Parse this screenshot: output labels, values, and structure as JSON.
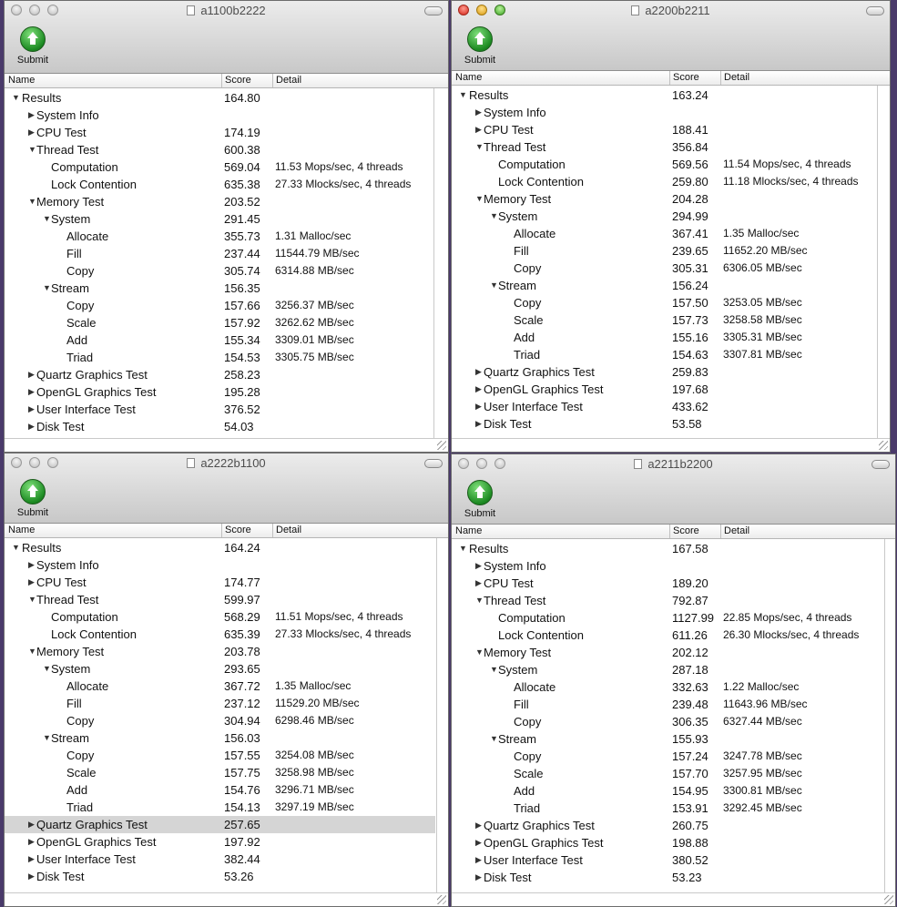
{
  "windows": [
    {
      "title": "a1100b2222",
      "active": false,
      "submit_label": "Submit",
      "columns": {
        "name": "Name",
        "score": "Score",
        "detail": "Detail"
      },
      "rows": [
        {
          "label": "Results",
          "score": "164.80",
          "detail": "",
          "level": 0,
          "expanded": true
        },
        {
          "label": "System Info",
          "score": "",
          "detail": "",
          "level": 1,
          "expanded": false
        },
        {
          "label": "CPU Test",
          "score": "174.19",
          "detail": "",
          "level": 1,
          "expanded": false
        },
        {
          "label": "Thread Test",
          "score": "600.38",
          "detail": "",
          "level": 1,
          "expanded": true
        },
        {
          "label": "Computation",
          "score": "569.04",
          "detail": "11.53 Mops/sec, 4 threads",
          "level": 2,
          "leaf": true
        },
        {
          "label": "Lock Contention",
          "score": "635.38",
          "detail": "27.33 Mlocks/sec, 4 threads",
          "level": 2,
          "leaf": true
        },
        {
          "label": "Memory Test",
          "score": "203.52",
          "detail": "",
          "level": 1,
          "expanded": true
        },
        {
          "label": "System",
          "score": "291.45",
          "detail": "",
          "level": 2,
          "expanded": true
        },
        {
          "label": "Allocate",
          "score": "355.73",
          "detail": "1.31 Malloc/sec",
          "level": 3,
          "leaf": true
        },
        {
          "label": "Fill",
          "score": "237.44",
          "detail": "11544.79 MB/sec",
          "level": 3,
          "leaf": true
        },
        {
          "label": "Copy",
          "score": "305.74",
          "detail": "6314.88 MB/sec",
          "level": 3,
          "leaf": true
        },
        {
          "label": "Stream",
          "score": "156.35",
          "detail": "",
          "level": 2,
          "expanded": true
        },
        {
          "label": "Copy",
          "score": "157.66",
          "detail": "3256.37 MB/sec",
          "level": 3,
          "leaf": true
        },
        {
          "label": "Scale",
          "score": "157.92",
          "detail": "3262.62 MB/sec",
          "level": 3,
          "leaf": true
        },
        {
          "label": "Add",
          "score": "155.34",
          "detail": "3309.01 MB/sec",
          "level": 3,
          "leaf": true
        },
        {
          "label": "Triad",
          "score": "154.53",
          "detail": "3305.75 MB/sec",
          "level": 3,
          "leaf": true
        },
        {
          "label": "Quartz Graphics Test",
          "score": "258.23",
          "detail": "",
          "level": 1,
          "expanded": false
        },
        {
          "label": "OpenGL Graphics Test",
          "score": "195.28",
          "detail": "",
          "level": 1,
          "expanded": false
        },
        {
          "label": "User Interface Test",
          "score": "376.52",
          "detail": "",
          "level": 1,
          "expanded": false
        },
        {
          "label": "Disk Test",
          "score": "54.03",
          "detail": "",
          "level": 1,
          "expanded": false
        }
      ]
    },
    {
      "title": "a2200b2211",
      "active": true,
      "submit_label": "Submit",
      "columns": {
        "name": "Name",
        "score": "Score",
        "detail": "Detail"
      },
      "rows": [
        {
          "label": "Results",
          "score": "163.24",
          "detail": "",
          "level": 0,
          "expanded": true
        },
        {
          "label": "System Info",
          "score": "",
          "detail": "",
          "level": 1,
          "expanded": false
        },
        {
          "label": "CPU Test",
          "score": "188.41",
          "detail": "",
          "level": 1,
          "expanded": false
        },
        {
          "label": "Thread Test",
          "score": "356.84",
          "detail": "",
          "level": 1,
          "expanded": true
        },
        {
          "label": "Computation",
          "score": "569.56",
          "detail": "11.54 Mops/sec, 4 threads",
          "level": 2,
          "leaf": true
        },
        {
          "label": "Lock Contention",
          "score": "259.80",
          "detail": "11.18 Mlocks/sec, 4 threads",
          "level": 2,
          "leaf": true
        },
        {
          "label": "Memory Test",
          "score": "204.28",
          "detail": "",
          "level": 1,
          "expanded": true
        },
        {
          "label": "System",
          "score": "294.99",
          "detail": "",
          "level": 2,
          "expanded": true
        },
        {
          "label": "Allocate",
          "score": "367.41",
          "detail": "1.35 Malloc/sec",
          "level": 3,
          "leaf": true
        },
        {
          "label": "Fill",
          "score": "239.65",
          "detail": "11652.20 MB/sec",
          "level": 3,
          "leaf": true
        },
        {
          "label": "Copy",
          "score": "305.31",
          "detail": "6306.05 MB/sec",
          "level": 3,
          "leaf": true
        },
        {
          "label": "Stream",
          "score": "156.24",
          "detail": "",
          "level": 2,
          "expanded": true
        },
        {
          "label": "Copy",
          "score": "157.50",
          "detail": "3253.05 MB/sec",
          "level": 3,
          "leaf": true
        },
        {
          "label": "Scale",
          "score": "157.73",
          "detail": "3258.58 MB/sec",
          "level": 3,
          "leaf": true
        },
        {
          "label": "Add",
          "score": "155.16",
          "detail": "3305.31 MB/sec",
          "level": 3,
          "leaf": true
        },
        {
          "label": "Triad",
          "score": "154.63",
          "detail": "3307.81 MB/sec",
          "level": 3,
          "leaf": true
        },
        {
          "label": "Quartz Graphics Test",
          "score": "259.83",
          "detail": "",
          "level": 1,
          "expanded": false
        },
        {
          "label": "OpenGL Graphics Test",
          "score": "197.68",
          "detail": "",
          "level": 1,
          "expanded": false
        },
        {
          "label": "User Interface Test",
          "score": "433.62",
          "detail": "",
          "level": 1,
          "expanded": false
        },
        {
          "label": "Disk Test",
          "score": "53.58",
          "detail": "",
          "level": 1,
          "expanded": false
        }
      ]
    },
    {
      "title": "a2222b1100",
      "active": false,
      "submit_label": "Submit",
      "columns": {
        "name": "Name",
        "score": "Score",
        "detail": "Detail"
      },
      "rows": [
        {
          "label": "Results",
          "score": "164.24",
          "detail": "",
          "level": 0,
          "expanded": true
        },
        {
          "label": "System Info",
          "score": "",
          "detail": "",
          "level": 1,
          "expanded": false
        },
        {
          "label": "CPU Test",
          "score": "174.77",
          "detail": "",
          "level": 1,
          "expanded": false
        },
        {
          "label": "Thread Test",
          "score": "599.97",
          "detail": "",
          "level": 1,
          "expanded": true
        },
        {
          "label": "Computation",
          "score": "568.29",
          "detail": "11.51 Mops/sec, 4 threads",
          "level": 2,
          "leaf": true
        },
        {
          "label": "Lock Contention",
          "score": "635.39",
          "detail": "27.33 Mlocks/sec, 4 threads",
          "level": 2,
          "leaf": true
        },
        {
          "label": "Memory Test",
          "score": "203.78",
          "detail": "",
          "level": 1,
          "expanded": true
        },
        {
          "label": "System",
          "score": "293.65",
          "detail": "",
          "level": 2,
          "expanded": true
        },
        {
          "label": "Allocate",
          "score": "367.72",
          "detail": "1.35 Malloc/sec",
          "level": 3,
          "leaf": true
        },
        {
          "label": "Fill",
          "score": "237.12",
          "detail": "11529.20 MB/sec",
          "level": 3,
          "leaf": true
        },
        {
          "label": "Copy",
          "score": "304.94",
          "detail": "6298.46 MB/sec",
          "level": 3,
          "leaf": true
        },
        {
          "label": "Stream",
          "score": "156.03",
          "detail": "",
          "level": 2,
          "expanded": true
        },
        {
          "label": "Copy",
          "score": "157.55",
          "detail": "3254.08 MB/sec",
          "level": 3,
          "leaf": true
        },
        {
          "label": "Scale",
          "score": "157.75",
          "detail": "3258.98 MB/sec",
          "level": 3,
          "leaf": true
        },
        {
          "label": "Add",
          "score": "154.76",
          "detail": "3296.71 MB/sec",
          "level": 3,
          "leaf": true
        },
        {
          "label": "Triad",
          "score": "154.13",
          "detail": "3297.19 MB/sec",
          "level": 3,
          "leaf": true
        },
        {
          "label": "Quartz Graphics Test",
          "score": "257.65",
          "detail": "",
          "level": 1,
          "expanded": false,
          "selected": true
        },
        {
          "label": "OpenGL Graphics Test",
          "score": "197.92",
          "detail": "",
          "level": 1,
          "expanded": false
        },
        {
          "label": "User Interface Test",
          "score": "382.44",
          "detail": "",
          "level": 1,
          "expanded": false
        },
        {
          "label": "Disk Test",
          "score": "53.26",
          "detail": "",
          "level": 1,
          "expanded": false
        }
      ]
    },
    {
      "title": "a2211b2200",
      "active": false,
      "submit_label": "Submit",
      "columns": {
        "name": "Name",
        "score": "Score",
        "detail": "Detail"
      },
      "rows": [
        {
          "label": "Results",
          "score": "167.58",
          "detail": "",
          "level": 0,
          "expanded": true
        },
        {
          "label": "System Info",
          "score": "",
          "detail": "",
          "level": 1,
          "expanded": false
        },
        {
          "label": "CPU Test",
          "score": "189.20",
          "detail": "",
          "level": 1,
          "expanded": false
        },
        {
          "label": "Thread Test",
          "score": "792.87",
          "detail": "",
          "level": 1,
          "expanded": true
        },
        {
          "label": "Computation",
          "score": "1127.99",
          "detail": "22.85 Mops/sec, 4 threads",
          "level": 2,
          "leaf": true
        },
        {
          "label": "Lock Contention",
          "score": "611.26",
          "detail": "26.30 Mlocks/sec, 4 threads",
          "level": 2,
          "leaf": true
        },
        {
          "label": "Memory Test",
          "score": "202.12",
          "detail": "",
          "level": 1,
          "expanded": true
        },
        {
          "label": "System",
          "score": "287.18",
          "detail": "",
          "level": 2,
          "expanded": true
        },
        {
          "label": "Allocate",
          "score": "332.63",
          "detail": "1.22 Malloc/sec",
          "level": 3,
          "leaf": true
        },
        {
          "label": "Fill",
          "score": "239.48",
          "detail": "11643.96 MB/sec",
          "level": 3,
          "leaf": true
        },
        {
          "label": "Copy",
          "score": "306.35",
          "detail": "6327.44 MB/sec",
          "level": 3,
          "leaf": true
        },
        {
          "label": "Stream",
          "score": "155.93",
          "detail": "",
          "level": 2,
          "expanded": true
        },
        {
          "label": "Copy",
          "score": "157.24",
          "detail": "3247.78 MB/sec",
          "level": 3,
          "leaf": true
        },
        {
          "label": "Scale",
          "score": "157.70",
          "detail": "3257.95 MB/sec",
          "level": 3,
          "leaf": true
        },
        {
          "label": "Add",
          "score": "154.95",
          "detail": "3300.81 MB/sec",
          "level": 3,
          "leaf": true
        },
        {
          "label": "Triad",
          "score": "153.91",
          "detail": "3292.45 MB/sec",
          "level": 3,
          "leaf": true
        },
        {
          "label": "Quartz Graphics Test",
          "score": "260.75",
          "detail": "",
          "level": 1,
          "expanded": false
        },
        {
          "label": "OpenGL Graphics Test",
          "score": "198.88",
          "detail": "",
          "level": 1,
          "expanded": false
        },
        {
          "label": "User Interface Test",
          "score": "380.52",
          "detail": "",
          "level": 1,
          "expanded": false
        },
        {
          "label": "Disk Test",
          "score": "53.23",
          "detail": "",
          "level": 1,
          "expanded": false
        }
      ]
    }
  ]
}
